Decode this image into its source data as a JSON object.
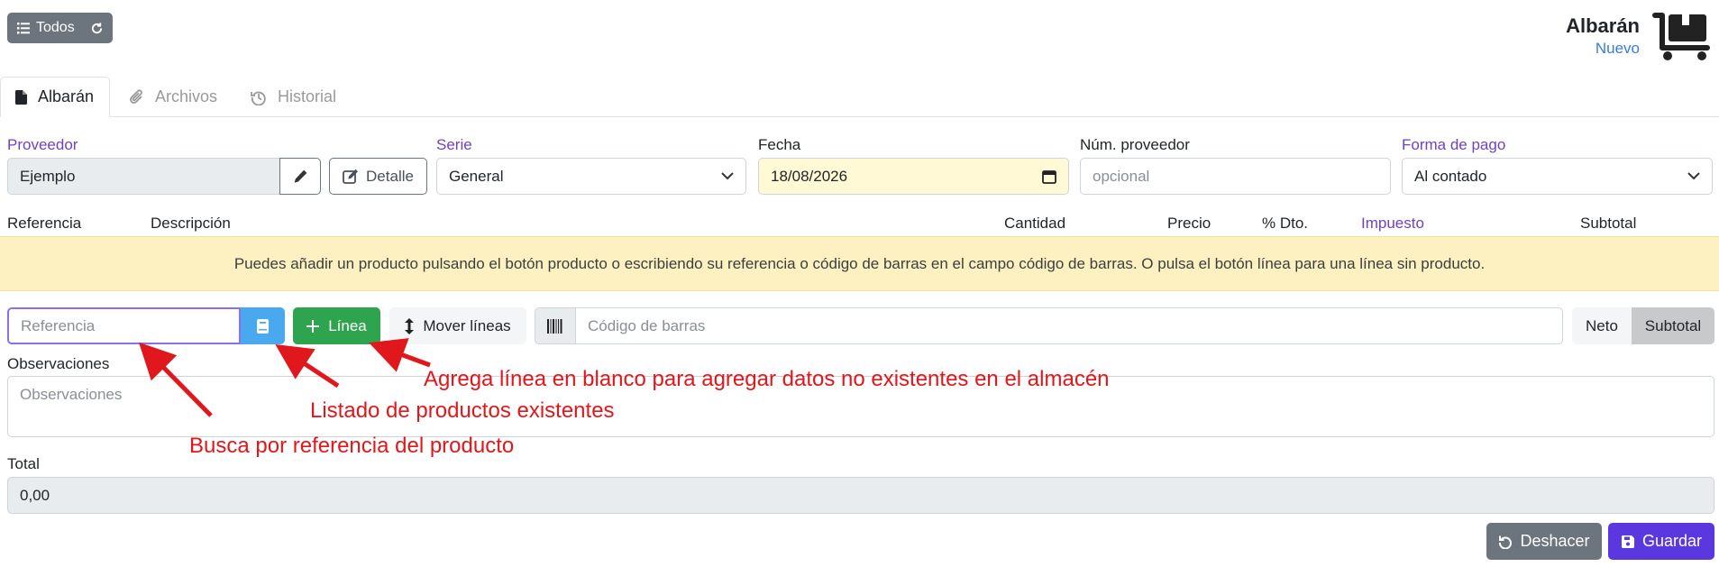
{
  "header": {
    "todos_label": "Todos",
    "doc_title": "Albarán",
    "doc_status": "Nuevo"
  },
  "tabs": [
    {
      "label": "Albarán",
      "icon": "file-icon",
      "active": true
    },
    {
      "label": "Archivos",
      "icon": "paperclip-icon",
      "active": false
    },
    {
      "label": "Historial",
      "icon": "history-icon",
      "active": false
    }
  ],
  "form": {
    "proveedor_label": "Proveedor",
    "proveedor_value": "Ejemplo",
    "detalle_label": "Detalle",
    "serie_label": "Serie",
    "serie_value": "General",
    "fecha_label": "Fecha",
    "fecha_value": "18/08/2026",
    "num_proveedor_label": "Núm. proveedor",
    "num_proveedor_placeholder": "opcional",
    "forma_pago_label": "Forma de pago",
    "forma_pago_value": "Al contado"
  },
  "lines_header": {
    "referencia": "Referencia",
    "descripcion": "Descripción",
    "cantidad": "Cantidad",
    "precio": "Precio",
    "dto": "% Dto.",
    "impuesto": "Impuesto",
    "subtotal": "Subtotal"
  },
  "banner_text": "Puedes añadir un producto pulsando el botón producto o escribiendo su referencia o código de barras en el campo código de barras. O pulsa el botón línea para una línea sin producto.",
  "toolbar": {
    "referencia_placeholder": "Referencia",
    "linea_label": "Línea",
    "mover_lineas_label": "Mover líneas",
    "barcode_placeholder": "Código de barras",
    "neto_label": "Neto",
    "subtotal_label": "Subtotal"
  },
  "observaciones": {
    "label": "Observaciones",
    "placeholder": "Observaciones"
  },
  "total": {
    "label": "Total",
    "value": "0,00"
  },
  "actions": {
    "deshacer_label": "Deshacer",
    "guardar_label": "Guardar"
  },
  "annotations": {
    "linea_note": "Agrega línea en blanco para agregar datos no existentes en el almacén",
    "listado_note": "Listado de productos existentes",
    "referencia_note": "Busca por referencia del producto"
  },
  "colors": {
    "primary": "#5b37e0",
    "success": "#2ea44f",
    "info": "#4aa8ee",
    "annotation": "#e0171c",
    "banner": "#fdf1c2"
  }
}
